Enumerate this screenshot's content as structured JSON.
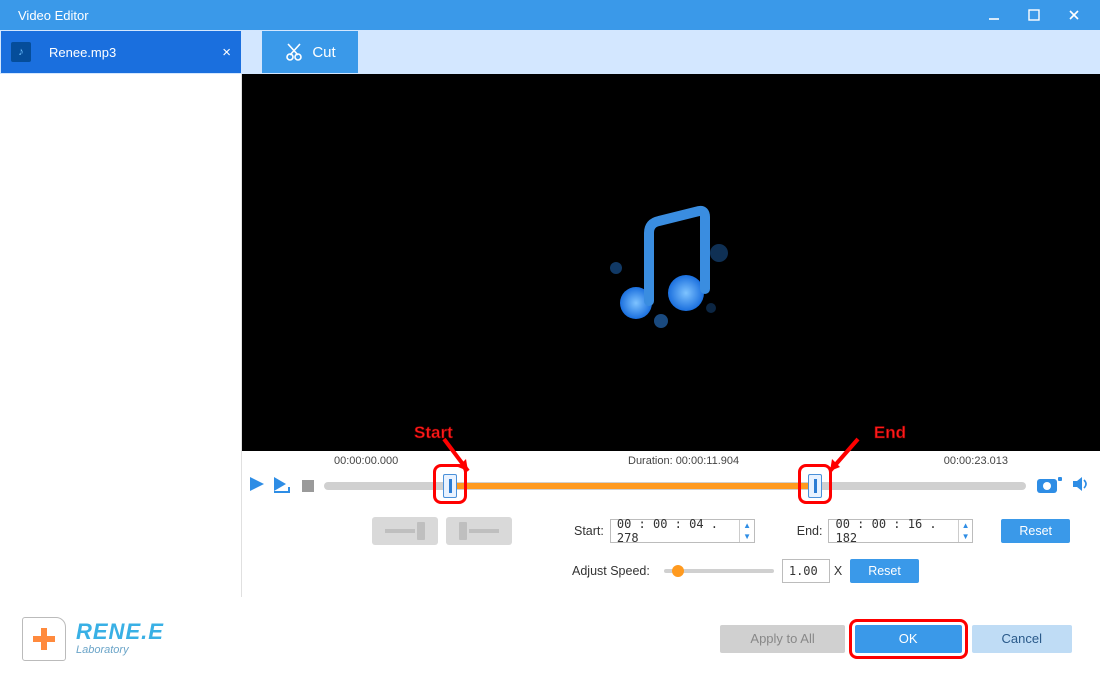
{
  "window": {
    "title": "Video Editor"
  },
  "file_tab": {
    "name": "Renee.mp3",
    "close_glyph": "×",
    "thumb_glyph": "♪"
  },
  "tool_tab": {
    "label": "Cut"
  },
  "timeline": {
    "t_start_label": "00:00:00.000",
    "t_duration_label": "Duration: 00:00:11.904",
    "t_end_label": "00:00:23.013",
    "sel_start_pct": 18,
    "sel_end_pct": 70
  },
  "annotations": {
    "start_label": "Start",
    "end_label": "End"
  },
  "controls": {
    "start_label": "Start:",
    "start_value": "00 : 00 : 04 . 278",
    "end_label": "End:",
    "end_value": "00 : 00 : 16 . 182",
    "reset_label": "Reset",
    "speed_label": "Adjust Speed:",
    "speed_value": "1.00",
    "speed_unit": "X"
  },
  "footer": {
    "brand": "RENE.E",
    "sub": "Laboratory",
    "apply_all": "Apply to All",
    "ok": "OK",
    "cancel": "Cancel"
  }
}
